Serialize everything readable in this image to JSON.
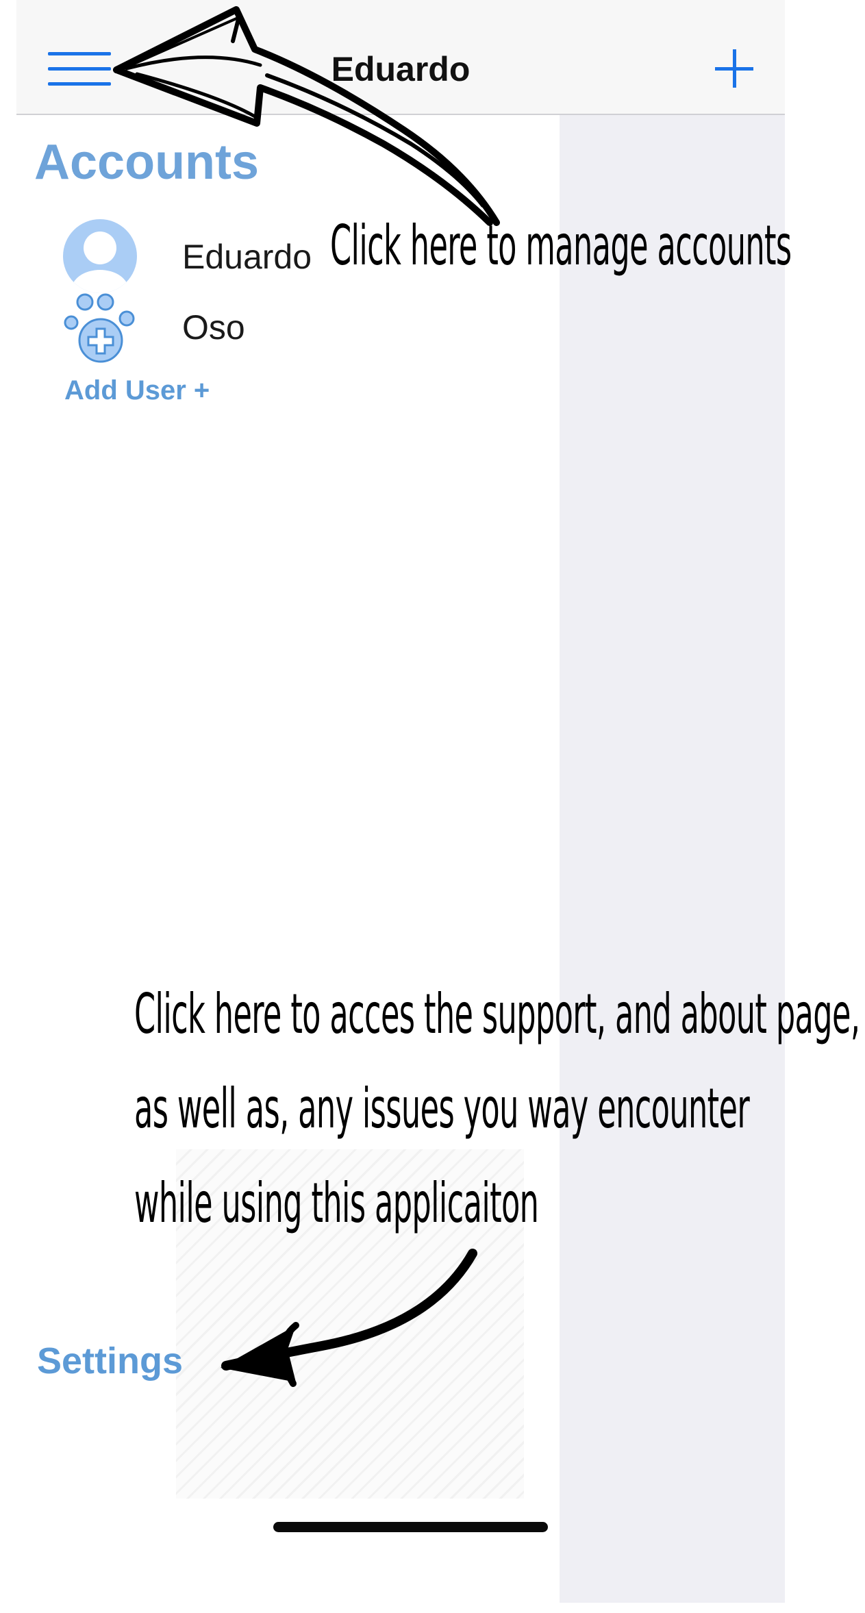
{
  "nav": {
    "title": "Eduardo",
    "menu_icon": "hamburger-menu-icon",
    "add_icon": "plus-icon",
    "accent_color": "#1a73e8"
  },
  "drawer": {
    "heading": "Accounts",
    "accounts": [
      {
        "name": "Eduardo",
        "icon": "user-avatar-icon"
      },
      {
        "name": "Oso",
        "icon": "pet-paw-plus-icon"
      }
    ],
    "add_user_label": "Add User +",
    "settings_label": "Settings",
    "link_color": "#5c9ad6"
  },
  "annotations": {
    "manage_accounts": "Click here to manage accounts",
    "settings_hint": [
      "Click here to acces the support, and about page,",
      "as well as, any issues you way encounter",
      "while using this applicaiton"
    ]
  }
}
